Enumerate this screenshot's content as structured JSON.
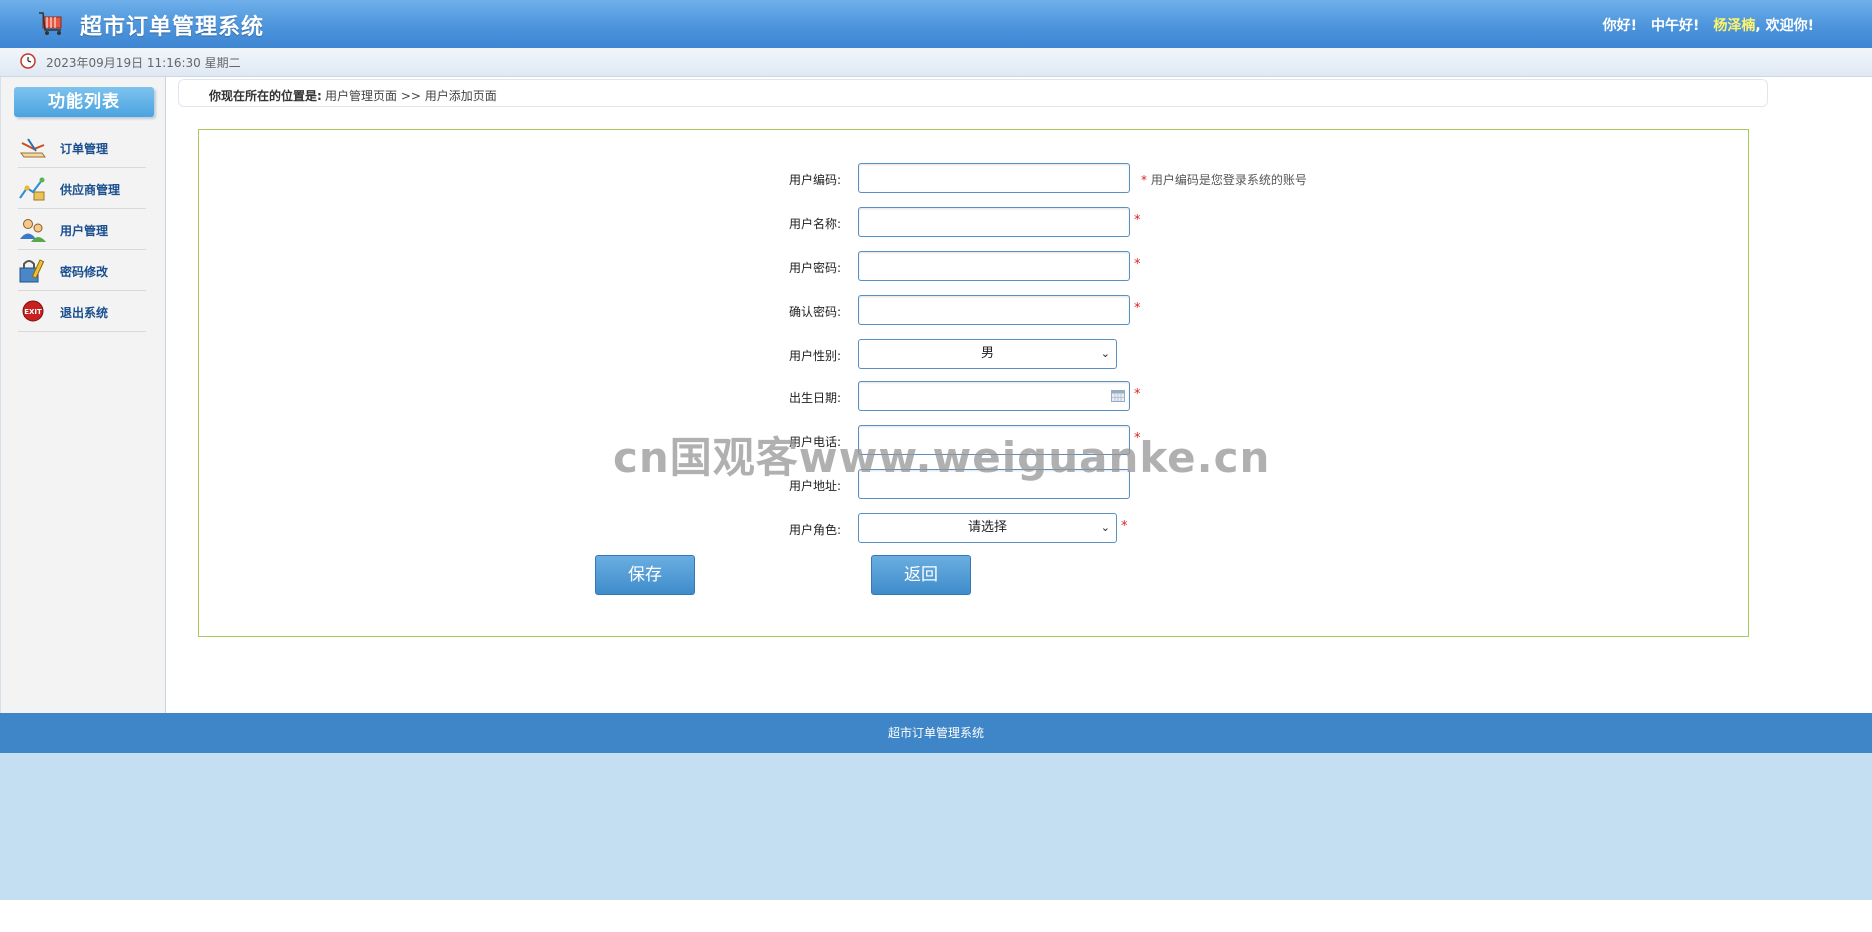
{
  "header": {
    "title": "超市订单管理系统",
    "greeting_1": "你好!",
    "greeting_2": "中午好!",
    "username": "杨泽楠",
    "welcome": ", 欢迎你!"
  },
  "subbar": {
    "datetime": "2023年09月19日 11:16:30 星期二"
  },
  "sidebar": {
    "title": "功能列表",
    "items": [
      {
        "label": "订单管理",
        "icon": "order-icon"
      },
      {
        "label": "供应商管理",
        "icon": "supplier-icon"
      },
      {
        "label": "用户管理",
        "icon": "users-icon"
      },
      {
        "label": "密码修改",
        "icon": "password-icon"
      },
      {
        "label": "退出系统",
        "icon": "exit-icon"
      }
    ]
  },
  "breadcrumb": {
    "prefix": "你现在所在的位置是:",
    "path": "用户管理页面 >> 用户添加页面"
  },
  "form": {
    "user_code": {
      "label": "用户编码:",
      "value": "",
      "hint": "用户编码是您登录系统的账号"
    },
    "user_name": {
      "label": "用户名称:",
      "value": ""
    },
    "user_password": {
      "label": "用户密码:",
      "value": ""
    },
    "confirm_password": {
      "label": "确认密码:",
      "value": ""
    },
    "gender": {
      "label": "用户性别:",
      "selected": "男"
    },
    "birthday": {
      "label": "出生日期:",
      "value": ""
    },
    "phone": {
      "label": "用户电话:",
      "value": ""
    },
    "address": {
      "label": "用户地址:",
      "value": ""
    },
    "role": {
      "label": "用户角色:",
      "selected": "请选择"
    },
    "required_mark": "*",
    "save_label": "保存",
    "back_label": "返回"
  },
  "footer": {
    "text": "超市订单管理系统"
  },
  "watermark": "cn国观客www.weiguanke.cn",
  "colors": {
    "header_blue": "#4c94dc",
    "footer_blue": "#3f86c8",
    "panel_border": "#a8c95a",
    "button_blue": "#4f9ad4",
    "required_red": "#e02020",
    "username_yellow": "#fff36b"
  }
}
